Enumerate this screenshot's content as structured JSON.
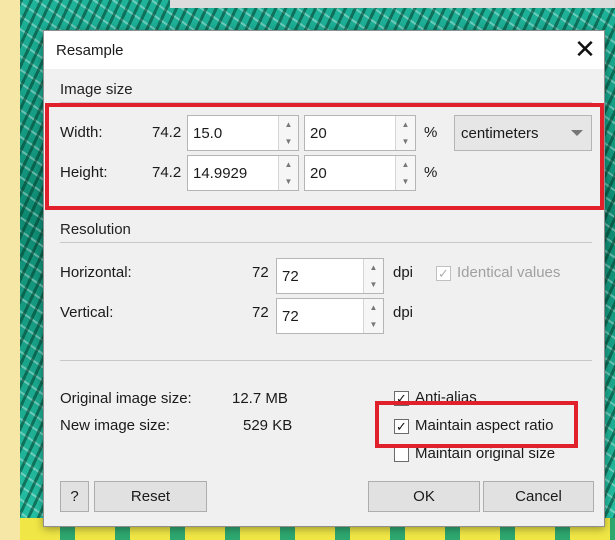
{
  "dialog": {
    "title": "Resample"
  },
  "image_size": {
    "section_title": "Image size",
    "width": {
      "label": "Width:",
      "original": "74.2",
      "value": "15.0",
      "percent": "20",
      "percent_symbol": "%"
    },
    "height": {
      "label": "Height:",
      "original": "74.2",
      "value": "14.9929",
      "percent": "20",
      "percent_symbol": "%"
    },
    "unit": "centimeters"
  },
  "resolution": {
    "section_title": "Resolution",
    "horizontal": {
      "label": "Horizontal:",
      "original": "72",
      "value": "72",
      "unit": "dpi"
    },
    "vertical": {
      "label": "Vertical:",
      "original": "72",
      "value": "72",
      "unit": "dpi"
    },
    "identical_values": {
      "label": "Identical values",
      "checked": true,
      "enabled": false
    }
  },
  "info": {
    "original_label": "Original image size:",
    "original_value": "12.7 MB",
    "new_label": "New image size:",
    "new_value": "529 KB"
  },
  "options": {
    "anti_alias": {
      "label": "Anti-alias",
      "checked": true
    },
    "maintain_aspect": {
      "label": "Maintain aspect ratio",
      "checked": true
    },
    "maintain_original": {
      "label": "Maintain original size",
      "checked": false
    }
  },
  "buttons": {
    "help": "?",
    "reset": "Reset",
    "ok": "OK",
    "cancel": "Cancel"
  },
  "highlight_color": "#e0212b"
}
